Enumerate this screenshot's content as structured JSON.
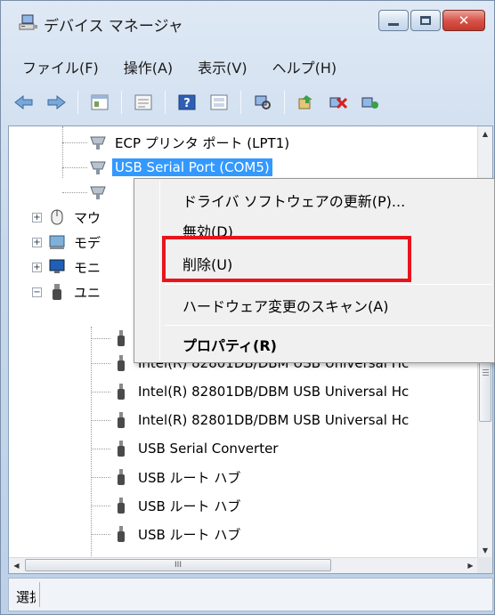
{
  "window": {
    "title": "デバイス マネージャ",
    "icon": "device-manager-icon",
    "min_icon": "minimize-icon",
    "max_icon": "maximize-icon",
    "close_icon": "close-icon",
    "close_color": "#d9534a"
  },
  "menu": {
    "items": [
      {
        "label": "ファイル(F)"
      },
      {
        "label": "操作(A)"
      },
      {
        "label": "表示(V)"
      },
      {
        "label": "ヘルプ(H)"
      }
    ]
  },
  "toolbar": {
    "buttons": [
      "back-arrow-icon",
      "forward-arrow-icon",
      "properties-icon",
      "device-view-icon",
      "help-icon",
      "update-driver-icon",
      "scan-hardware-icon",
      "update-icon",
      "uninstall-icon",
      "enable-device-icon"
    ]
  },
  "tree": {
    "rows": [
      {
        "label": "ECP プリンタ ポート (LPT1)",
        "icon": "port-icon"
      },
      {
        "label": "USB Serial Port (COM5)",
        "icon": "port-icon",
        "selected": true
      },
      {
        "label": "",
        "icon": "port-icon"
      },
      {
        "label": "マウ",
        "icon": "mouse-icon"
      },
      {
        "label": "モデ",
        "icon": "modem-icon"
      },
      {
        "label": "モニ",
        "icon": "monitor-icon"
      },
      {
        "label": "ユニ",
        "icon": "usb-controller-icon"
      },
      {
        "label": "",
        "icon": "usb-icon"
      },
      {
        "label": "Intel(R) 82801DB/DBM USB Universal Hc",
        "icon": "usb-icon"
      },
      {
        "label": "Intel(R) 82801DB/DBM USB Universal Hc",
        "icon": "usb-icon"
      },
      {
        "label": "Intel(R) 82801DB/DBM USB Universal Hc",
        "icon": "usb-icon"
      },
      {
        "label": "USB Serial Converter",
        "icon": "usb-icon"
      },
      {
        "label": "USB ルート ハブ",
        "icon": "usb-icon"
      },
      {
        "label": "USB ルート ハブ",
        "icon": "usb-icon"
      },
      {
        "label": "USB ルート ハブ",
        "icon": "usb-icon"
      }
    ],
    "selection_color": "#3399ff"
  },
  "context_menu": {
    "items": [
      {
        "label": "ドライバ ソフトウェアの更新(P)..."
      },
      {
        "label": "無効(D)"
      },
      {
        "label": "削除(U)"
      },
      {
        "label": "ハードウェア変更のスキャン(A)"
      },
      {
        "label": "プロパティ(R)",
        "bold": true
      }
    ],
    "highlight_color": "#e8141c"
  },
  "hscroll": {
    "thumb_label": "III"
  },
  "status": {
    "text": "選択"
  }
}
